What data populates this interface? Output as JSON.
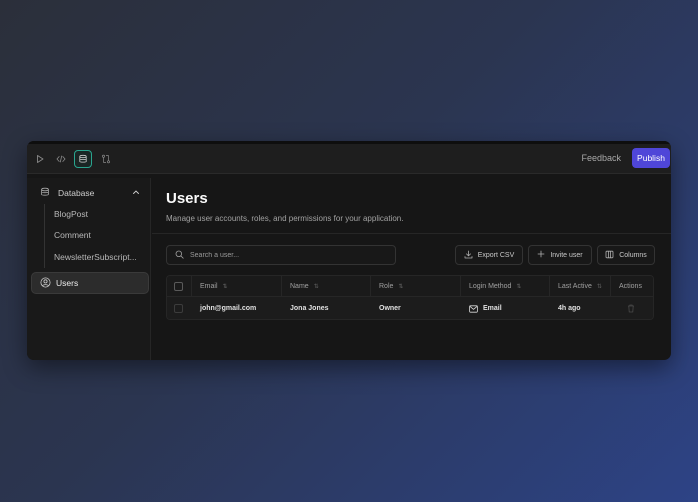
{
  "topbar": {
    "feedback_label": "Feedback",
    "publish_label": "Publish",
    "tools": [
      "play-icon",
      "code-icon",
      "database-icon",
      "git-compare-icon"
    ],
    "active_tool": "database-icon",
    "accent_color": "#4f46d8"
  },
  "sidebar": {
    "database_label": "Database",
    "items": [
      {
        "label": "BlogPost"
      },
      {
        "label": "Comment"
      },
      {
        "label": "NewsletterSubscript..."
      }
    ],
    "users_label": "Users"
  },
  "main": {
    "title": "Users",
    "subtitle": "Manage user accounts, roles, and permissions for your application.",
    "search_placeholder": "Search a user...",
    "export_label": "Export CSV",
    "invite_label": "Invite user",
    "columns_label": "Columns",
    "table": {
      "headers": [
        "Email",
        "Name",
        "Role",
        "Login Method",
        "Last Active",
        "Actions"
      ],
      "rows": [
        {
          "email": "john@gmail.com",
          "name": "Jona Jones",
          "role": "Owner",
          "login_method": "Email",
          "last_active": "4h ago"
        }
      ]
    }
  }
}
